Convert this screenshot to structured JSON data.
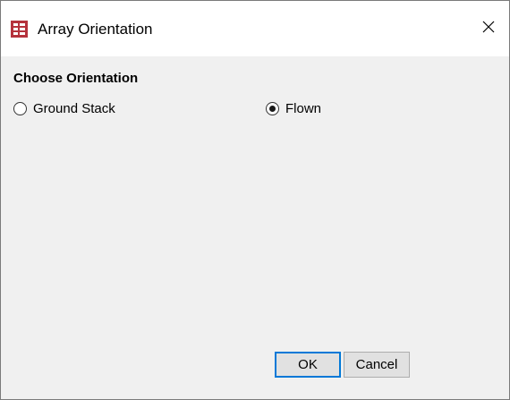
{
  "window": {
    "title": "Array Orientation",
    "icon": "app-window-icon",
    "close_icon": "close-icon"
  },
  "orientation": {
    "group_label": "Choose Orientation",
    "options": [
      {
        "label": "Ground Stack",
        "selected": false
      },
      {
        "label": "Flown",
        "selected": true
      }
    ]
  },
  "buttons": {
    "ok_label": "OK",
    "cancel_label": "Cancel"
  },
  "colors": {
    "icon_red": "#b5323c",
    "default_button_border": "#0078d7",
    "dialog_background": "#f0f0f0"
  }
}
